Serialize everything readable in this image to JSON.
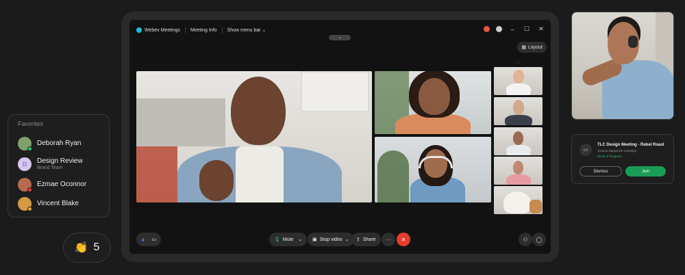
{
  "favorites": {
    "title": "Favorites",
    "items": [
      {
        "name": "Deborah Ryan",
        "subtitle": "",
        "avatar_color": "#7fa06b",
        "status_color": "#2fbf71"
      },
      {
        "name": "Design Review",
        "subtitle": "Brand Team",
        "avatar_letter": "D",
        "avatar_color": "#d7c7f0",
        "status_color": ""
      },
      {
        "name": "Ezmae Oconnor",
        "subtitle": "",
        "avatar_color": "#b86a50",
        "status_color": "#e33d2b"
      },
      {
        "name": "Vincent Blake",
        "subtitle": "",
        "avatar_color": "#d49a44",
        "status_color": "#f0a23a"
      }
    ]
  },
  "reaction": {
    "icon": "clapping-hands-icon",
    "glyph": "👏",
    "count": "5"
  },
  "titlebar": {
    "app_name": "Webex Meetings",
    "meeting_info": "Meeting Info",
    "menu_bar": "Show menu bar",
    "minimize": "–",
    "maximize": "☐",
    "close": "✕"
  },
  "layout_button": "Layout",
  "controls": {
    "mute": "Mute",
    "stop_video": "Stop video",
    "share": "Share",
    "more": "···",
    "end": "✕"
  },
  "notification": {
    "title": "TLC Design Meeting - Rebel Roast",
    "subtitle": "Jessica started the meetings",
    "status": "00:02 In Progress",
    "dismiss": "Dismiss",
    "join": "Join"
  },
  "colors": {
    "accent_green": "#1a9c57",
    "end_call_red": "#e33d2b",
    "background": "#1b1b1b"
  }
}
